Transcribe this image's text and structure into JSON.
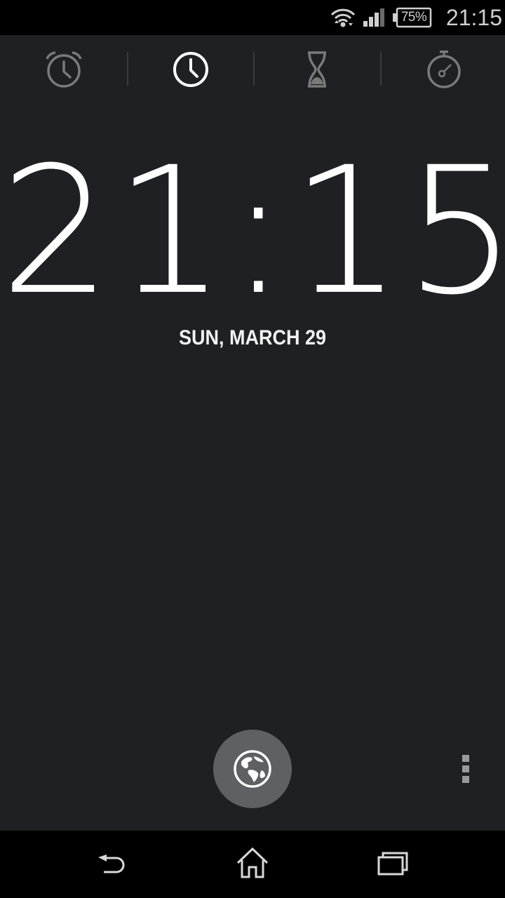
{
  "status_bar": {
    "battery_percent": "75%",
    "time": "21:15",
    "icons": [
      "wifi-icon",
      "signal-icon",
      "battery-icon"
    ]
  },
  "tabs": [
    {
      "id": "alarm",
      "icon": "alarm-clock-icon",
      "selected": false
    },
    {
      "id": "clock",
      "icon": "clock-icon",
      "selected": true
    },
    {
      "id": "timer",
      "icon": "hourglass-icon",
      "selected": false
    },
    {
      "id": "stopwatch",
      "icon": "stopwatch-icon",
      "selected": false
    }
  ],
  "clock": {
    "time": "21:15",
    "date": "SUN, MARCH 29"
  },
  "actions": {
    "world_clock_icon": "globe-icon",
    "overflow_icon": "overflow-menu-icon"
  },
  "nav_bar": {
    "icons": [
      "back-icon",
      "home-icon",
      "recents-icon"
    ]
  },
  "colors": {
    "background": "#1f2023",
    "bars": "#000000",
    "fab": "#5f6063",
    "icon_inactive": "#7a7a7a",
    "icon_active": "#ffffff"
  }
}
